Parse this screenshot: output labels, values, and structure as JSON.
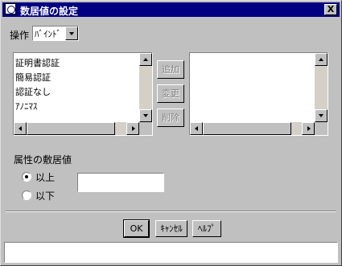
{
  "window": {
    "title": "数居値の設定",
    "close_label": "X"
  },
  "operation": {
    "label": "操作",
    "selected": "ﾊﾞｲﾝﾄﾞ"
  },
  "left_list": {
    "items": [
      "証明書認証",
      "簡易認証",
      "認証なし",
      "ｱﾉﾆﾏｽ"
    ]
  },
  "middle_buttons": {
    "add": "追加",
    "change": "変更",
    "delete": "削除"
  },
  "threshold": {
    "label": "属性の敷居値",
    "options": [
      {
        "label": "以上",
        "checked": true
      },
      {
        "label": "以下",
        "checked": false
      }
    ],
    "value": ""
  },
  "footer": {
    "ok": "OK",
    "cancel": "ｷｬﾝｾﾙ",
    "help": "ﾍﾙﾌﾟ"
  },
  "status": {
    "text": ""
  }
}
